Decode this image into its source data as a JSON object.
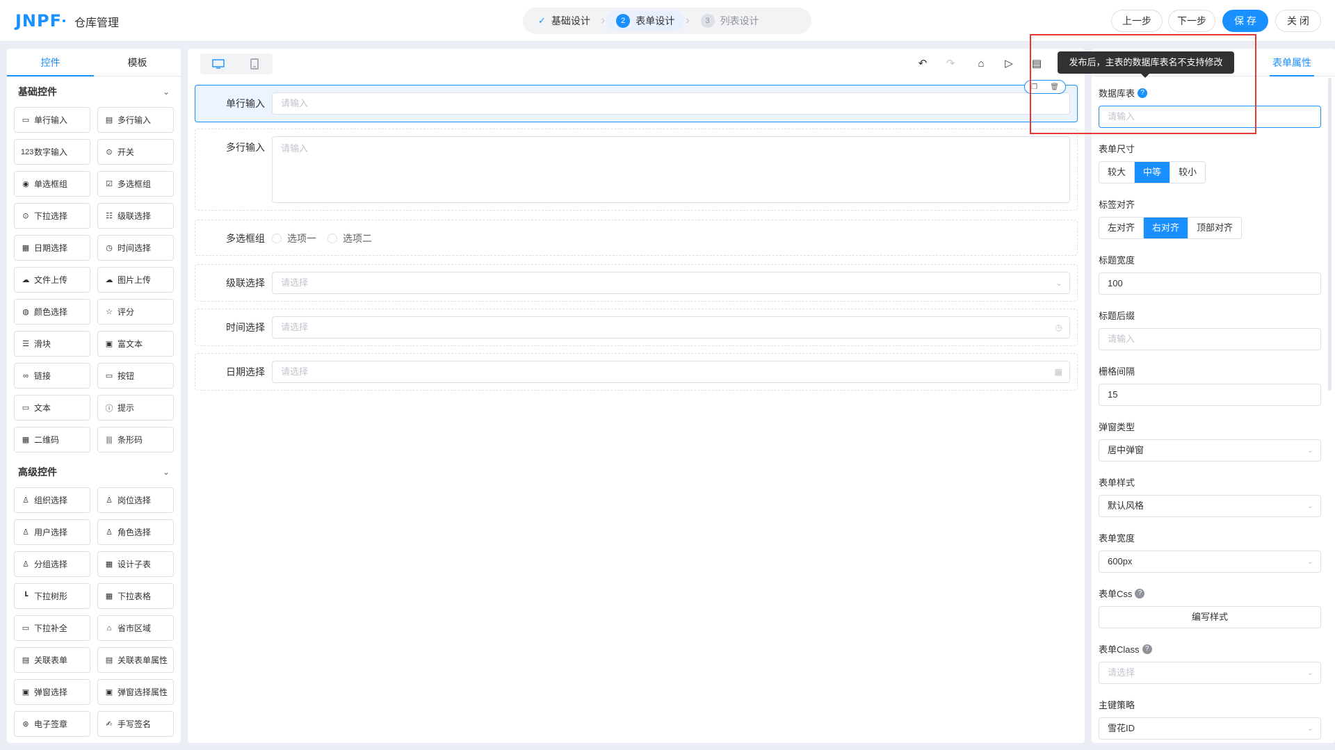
{
  "header": {
    "logo": "JNPF",
    "app_title": "仓库管理",
    "steps": [
      {
        "num": "",
        "label": "基础设计"
      },
      {
        "num": "2",
        "label": "表单设计"
      },
      {
        "num": "3",
        "label": "列表设计"
      }
    ],
    "buttons": {
      "prev": "上一步",
      "next": "下一步",
      "save": "保 存",
      "close": "关 闭"
    }
  },
  "left_panel": {
    "tabs": [
      "控件",
      "模板"
    ],
    "basic_title": "基础控件",
    "basic": [
      {
        "icon": "input-icon",
        "glyph": "▭",
        "label": "单行输入"
      },
      {
        "icon": "textarea-icon",
        "glyph": "▤",
        "label": "多行输入"
      },
      {
        "icon": "number-icon",
        "glyph": "123",
        "label": "数字输入"
      },
      {
        "icon": "switch-icon",
        "glyph": "⊙",
        "label": "开关"
      },
      {
        "icon": "radio-icon",
        "glyph": "◉",
        "label": "单选框组"
      },
      {
        "icon": "checkbox-icon",
        "glyph": "☑",
        "label": "多选框组"
      },
      {
        "icon": "select-icon",
        "glyph": "⊙",
        "label": "下拉选择"
      },
      {
        "icon": "cascader-icon",
        "glyph": "☷",
        "label": "级联选择"
      },
      {
        "icon": "date-icon",
        "glyph": "▦",
        "label": "日期选择"
      },
      {
        "icon": "time-icon",
        "glyph": "◷",
        "label": "时间选择"
      },
      {
        "icon": "upload-file-icon",
        "glyph": "☁",
        "label": "文件上传"
      },
      {
        "icon": "upload-image-icon",
        "glyph": "☁",
        "label": "图片上传"
      },
      {
        "icon": "color-icon",
        "glyph": "◍",
        "label": "颜色选择"
      },
      {
        "icon": "rate-icon",
        "glyph": "☆",
        "label": "评分"
      },
      {
        "icon": "slider-icon",
        "glyph": "☰",
        "label": "滑块"
      },
      {
        "icon": "richtext-icon",
        "glyph": "▣",
        "label": "富文本"
      },
      {
        "icon": "link-icon",
        "glyph": "∞",
        "label": "链接"
      },
      {
        "icon": "button-icon",
        "glyph": "▭",
        "label": "按钮"
      },
      {
        "icon": "text-icon",
        "glyph": "▭",
        "label": "文本"
      },
      {
        "icon": "alert-icon",
        "glyph": "ⓘ",
        "label": "提示"
      },
      {
        "icon": "qrcode-icon",
        "glyph": "▦",
        "label": "二维码"
      },
      {
        "icon": "barcode-icon",
        "glyph": "|||",
        "label": "条形码"
      }
    ],
    "advanced_title": "高级控件",
    "advanced": [
      {
        "icon": "org-icon",
        "glyph": "♙",
        "label": "组织选择"
      },
      {
        "icon": "position-icon",
        "glyph": "♙",
        "label": "岗位选择"
      },
      {
        "icon": "user-icon",
        "glyph": "♙",
        "label": "用户选择"
      },
      {
        "icon": "role-icon",
        "glyph": "♙",
        "label": "角色选择"
      },
      {
        "icon": "group-icon",
        "glyph": "♙",
        "label": "分组选择"
      },
      {
        "icon": "table-icon",
        "glyph": "▦",
        "label": "设计子表"
      },
      {
        "icon": "tree-icon",
        "glyph": "┗",
        "label": "下拉树形"
      },
      {
        "icon": "select-table-icon",
        "glyph": "▦",
        "label": "下拉表格"
      },
      {
        "icon": "autocomplete-icon",
        "glyph": "▭",
        "label": "下拉补全"
      },
      {
        "icon": "area-icon",
        "glyph": "⌂",
        "label": "省市区域"
      },
      {
        "icon": "relation-form-icon",
        "glyph": "▤",
        "label": "关联表单"
      },
      {
        "icon": "relation-attr-icon",
        "glyph": "▤",
        "label": "关联表单属性"
      },
      {
        "icon": "popup-select-icon",
        "glyph": "▣",
        "label": "弹窗选择"
      },
      {
        "icon": "popup-attr-icon",
        "glyph": "▣",
        "label": "弹窗选择属性"
      },
      {
        "icon": "e-sign-icon",
        "glyph": "⊛",
        "label": "电子签章"
      },
      {
        "icon": "hand-sign-icon",
        "glyph": "✍",
        "label": "手写签名"
      }
    ]
  },
  "canvas": {
    "fields": [
      {
        "label": "单行输入",
        "placeholder": "请输入"
      },
      {
        "label": "多行输入",
        "placeholder": "请输入"
      },
      {
        "label": "多选框组",
        "options": [
          "选项一",
          "选项二"
        ]
      },
      {
        "label": "级联选择",
        "placeholder": "请选择"
      },
      {
        "label": "时间选择",
        "placeholder": "请选择"
      },
      {
        "label": "日期选择",
        "placeholder": "请选择"
      }
    ]
  },
  "right_panel": {
    "tab": "表单属性",
    "tooltip": "发布后，主表的数据库表名不支持修改",
    "db_table_label": "数据库表",
    "db_table_placeholder": "请输入",
    "form_size_label": "表单尺寸",
    "form_size_options": [
      "较大",
      "中等",
      "较小"
    ],
    "label_align_label": "标签对齐",
    "label_align_options": [
      "左对齐",
      "右对齐",
      "顶部对齐"
    ],
    "label_width_label": "标题宽度",
    "label_width_value": "100",
    "label_suffix_label": "标题后缀",
    "label_suffix_placeholder": "请输入",
    "gutter_label": "栅格间隔",
    "gutter_value": "15",
    "popup_type_label": "弹窗类型",
    "popup_type_value": "居中弹窗",
    "form_style_label": "表单样式",
    "form_style_value": "默认风格",
    "form_width_label": "表单宽度",
    "form_width_value": "600px",
    "form_css_label": "表单Css",
    "form_css_button": "编写样式",
    "form_class_label": "表单Class",
    "form_class_placeholder": "请选择",
    "pk_label": "主键策略",
    "pk_value": "雪花ID"
  }
}
